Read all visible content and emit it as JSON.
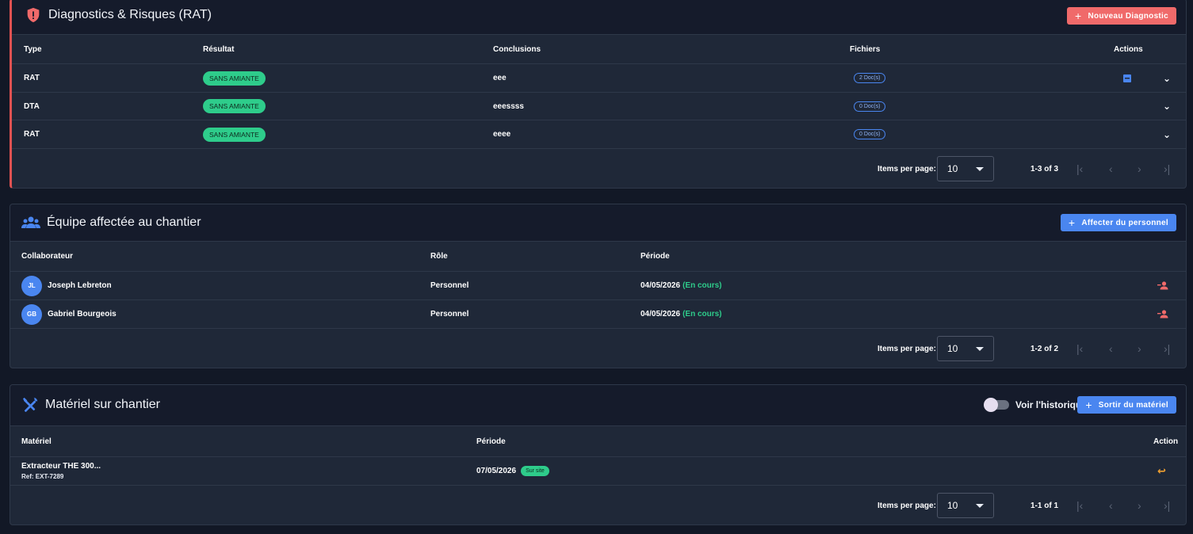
{
  "diagnostics": {
    "title": "Diagnostics & Risques (RAT)",
    "add_label": "Nouveau Diagnostic",
    "columns": [
      "Type",
      "Résultat",
      "Conclusions",
      "Fichiers",
      "Actions"
    ],
    "rows": [
      {
        "type": "RAT",
        "result": "SANS AMIANTE",
        "conclusion": "eee",
        "files": "2 Doc(s)",
        "has_pdf": true
      },
      {
        "type": "DTA",
        "result": "SANS AMIANTE",
        "conclusion": "eeessss",
        "files": "0 Doc(s)",
        "has_pdf": false
      },
      {
        "type": "RAT",
        "result": "SANS AMIANTE",
        "conclusion": "eeee",
        "files": "0 Doc(s)",
        "has_pdf": false
      }
    ],
    "pager": {
      "items_label": "Items per page:",
      "per_page": "10",
      "range": "1-3 of 3"
    }
  },
  "team": {
    "title": "Équipe affectée au chantier",
    "add_label": "Affecter du personnel",
    "columns": [
      "Collaborateur",
      "Rôle",
      "Période"
    ],
    "rows": [
      {
        "initials": "JL",
        "name": "Joseph Lebreton",
        "role": "Personnel",
        "date": "04/05/2026",
        "status": "(En cours)"
      },
      {
        "initials": "GB",
        "name": "Gabriel Bourgeois",
        "role": "Personnel",
        "date": "04/05/2026",
        "status": "(En cours)"
      }
    ],
    "pager": {
      "items_label": "Items per page:",
      "per_page": "10",
      "range": "1-2 of 2"
    }
  },
  "equipment": {
    "title": "Matériel sur chantier",
    "toggle_label": "Voir l'historique",
    "add_label": "Sortir du matériel",
    "columns": [
      "Matériel",
      "Période",
      "Action"
    ],
    "rows": [
      {
        "name": "Extracteur THE 300...",
        "ref": "Ref: EXT-7289",
        "date": "07/05/2026",
        "badge": "Sur site"
      }
    ],
    "pager": {
      "items_label": "Items per page:",
      "per_page": "10",
      "range": "1-1 of 1"
    }
  },
  "colors": {
    "accent_blue": "#4a86f0",
    "accent_red": "#f06a6a",
    "accent_green": "#2ecc8b",
    "return_orange": "#f0a030"
  }
}
